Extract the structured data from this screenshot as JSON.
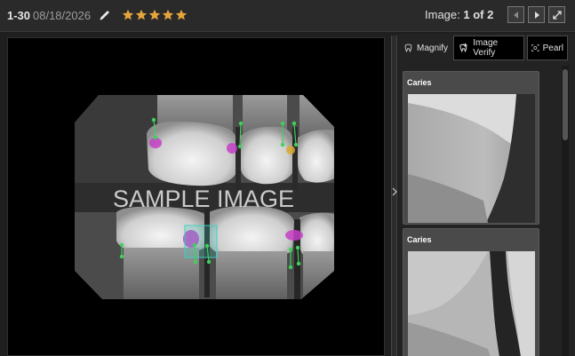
{
  "header": {
    "record_id": "1-30",
    "date": "08/18/2026",
    "rating": 5,
    "image_label": "Image:",
    "image_index": "1",
    "image_of": "of",
    "image_total": "2",
    "star_color": "#e5a43c"
  },
  "viewer": {
    "watermark": "SAMPLE IMAGE"
  },
  "tabs": [
    {
      "label": "Magnify",
      "icon": "tooth-magnify-icon"
    },
    {
      "label": "Image Verify",
      "icon": "image-verify-icon"
    },
    {
      "label": "Pearl",
      "icon": "pearl-icon"
    }
  ],
  "findings": [
    {
      "label": "Caries"
    },
    {
      "label": "Caries"
    }
  ],
  "colors": {
    "caries": "#c640c6",
    "restoration": "#d9a830",
    "bone_marker": "#3fd15a",
    "selection": "#3fd0c0"
  }
}
